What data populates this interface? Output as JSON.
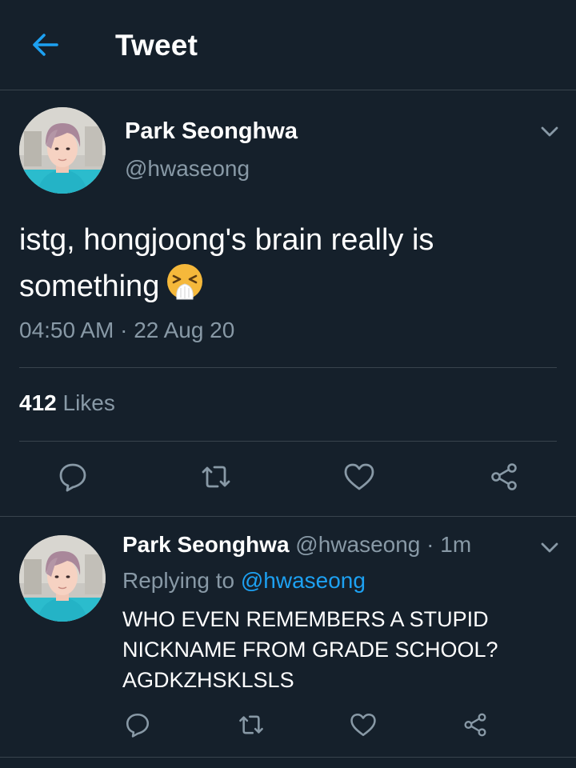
{
  "header": {
    "title": "Tweet",
    "back_icon": "arrow-left-icon",
    "accent": "#1da1f2"
  },
  "colors": {
    "background": "#15202b",
    "divider": "#38444d",
    "secondary_text": "#8899a6",
    "link": "#1da1f2"
  },
  "main_tweet": {
    "author_name": "Park Seonghwa",
    "handle": "@hwaseong",
    "text": "istg, hongjoong's brain really is something",
    "emoji": "sneezing-face-emoji",
    "time": "04:50 AM",
    "separator": "·",
    "date": "22 Aug 20",
    "likes_count": "412",
    "likes_label": "Likes",
    "actions": [
      "reply-icon",
      "retweet-icon",
      "like-icon",
      "share-icon"
    ]
  },
  "reply_tweet": {
    "author_name": "Park Seonghwa",
    "handle": "@hwaseong",
    "time_ago": "· 1m",
    "replying_prefix": "Replying to",
    "replying_to": "@hwaseong",
    "text": "WHO EVEN REMEMBERS A STUPID NICKNAME FROM GRADE SCHOOL? AGDKZHSKLSLS",
    "actions": [
      "reply-icon",
      "retweet-icon",
      "like-icon",
      "share-icon"
    ]
  }
}
